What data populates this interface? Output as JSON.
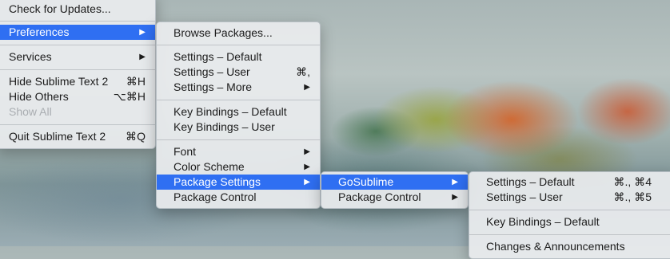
{
  "app_menu": {
    "items": [
      {
        "label": "Check for Updates..."
      },
      {
        "label": "Preferences",
        "submenu": true,
        "selected": true
      },
      {
        "label": "Services",
        "submenu": true
      },
      {
        "label": "Hide Sublime Text 2",
        "shortcut": "⌘H"
      },
      {
        "label": "Hide Others",
        "shortcut": "⌥⌘H"
      },
      {
        "label": "Show All",
        "disabled": true
      },
      {
        "label": "Quit Sublime Text 2",
        "shortcut": "⌘Q"
      }
    ]
  },
  "preferences_menu": {
    "items": [
      {
        "label": "Browse Packages..."
      },
      {
        "label": "Settings – Default"
      },
      {
        "label": "Settings – User",
        "shortcut": "⌘,"
      },
      {
        "label": "Settings – More",
        "submenu": true
      },
      {
        "label": "Key Bindings – Default"
      },
      {
        "label": "Key Bindings – User"
      },
      {
        "label": "Font",
        "submenu": true
      },
      {
        "label": "Color Scheme",
        "submenu": true
      },
      {
        "label": "Package Settings",
        "submenu": true,
        "selected": true
      },
      {
        "label": "Package Control"
      }
    ]
  },
  "package_settings_menu": {
    "items": [
      {
        "label": "GoSublime",
        "submenu": true,
        "selected": true
      },
      {
        "label": "Package Control",
        "submenu": true
      }
    ]
  },
  "gosublime_menu": {
    "items": [
      {
        "label": "Settings – Default",
        "shortcut": "⌘., ⌘4"
      },
      {
        "label": "Settings – User",
        "shortcut": "⌘., ⌘5"
      },
      {
        "label": "Key Bindings – Default"
      },
      {
        "label": "Changes & Announcements"
      }
    ]
  },
  "glyphs": {
    "submenu_arrow": "▶"
  },
  "colors": {
    "selection": "#2f6ff2",
    "disabled_text": "#a9adb1"
  }
}
